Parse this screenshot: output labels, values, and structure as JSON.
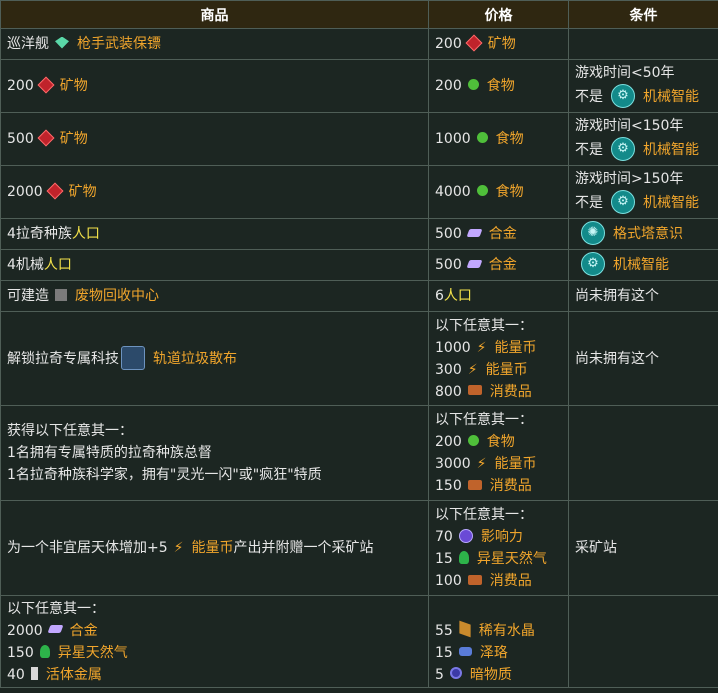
{
  "headers": {
    "col1": "商品",
    "col2": "价格",
    "col3": "条件"
  },
  "rows": [
    {
      "c1": {
        "pre": "巡洋舰",
        "name": "枪手武装保镖"
      },
      "c2": {
        "num": "200",
        "name": "矿物"
      }
    },
    {
      "c1": {
        "num": "200",
        "name": "矿物"
      },
      "c2": {
        "num": "200",
        "name": "食物"
      },
      "c3": {
        "cond": "游戏时间<50年",
        "neg": "不是",
        "name": "机械智能"
      }
    },
    {
      "c1": {
        "num": "500",
        "name": "矿物"
      },
      "c2": {
        "num": "1000",
        "name": "食物"
      },
      "c3": {
        "cond": "游戏时间<150年",
        "neg": "不是",
        "name": "机械智能"
      }
    },
    {
      "c1": {
        "num": "2000",
        "name": "矿物"
      },
      "c2": {
        "num": "4000",
        "name": "食物"
      },
      "c3": {
        "cond": "游戏时间>150年",
        "neg": "不是",
        "name": "机械智能"
      }
    },
    {
      "c1": {
        "pre": "4拉奇种族",
        "name": "人口"
      },
      "c2": {
        "num": "500",
        "name": "合金"
      },
      "c3": {
        "name": "格式塔意识"
      }
    },
    {
      "c1": {
        "pre": "4机械",
        "name": "人口"
      },
      "c2": {
        "num": "500",
        "name": "合金"
      },
      "c3": {
        "name": "机械智能"
      }
    },
    {
      "c1": {
        "pre": "可建造",
        "name": "废物回收中心"
      },
      "c2": {
        "num": "6",
        "name": "人口"
      },
      "c3": {
        "text": "尚未拥有这个"
      }
    },
    {
      "c1": {
        "pre": "解锁拉奇专属科技",
        "name": "轨道垃圾散布"
      },
      "c2": {
        "intro": "以下任意其一：",
        "items": [
          {
            "num": "1000",
            "name": "能量币"
          },
          {
            "num": "300",
            "name": "能量币"
          },
          {
            "num": "800",
            "name": "消费品"
          }
        ]
      },
      "c3": {
        "text": "尚未拥有这个"
      }
    },
    {
      "c1": {
        "lines": [
          "获得以下任意其一：",
          "1名拥有专属特质的拉奇种族总督",
          "1名拉奇种族科学家，拥有\"灵光一闪\"或\"疯狂\"特质"
        ]
      },
      "c2": {
        "intro": "以下任意其一：",
        "items": [
          {
            "num": "200",
            "name": "食物"
          },
          {
            "num": "3000",
            "name": "能量币"
          },
          {
            "num": "150",
            "name": "消费品"
          }
        ]
      }
    },
    {
      "c1": {
        "pre": "为一个非宜居天体增加+5",
        "name": "能量币",
        "post": "产出并附赠一个采矿站"
      },
      "c2": {
        "intro": "以下任意其一：",
        "items": [
          {
            "num": "70",
            "name": "影响力"
          },
          {
            "num": "15",
            "name": "异星天然气"
          },
          {
            "num": "100",
            "name": "消费品"
          }
        ]
      },
      "c3": {
        "text": "采矿站"
      }
    },
    {
      "c1": {
        "intro": "以下任意其一：",
        "items": [
          {
            "num": "2000",
            "name": "合金"
          },
          {
            "num": "150",
            "name": "异星天然气"
          },
          {
            "num": "40",
            "name": "活体金属"
          }
        ]
      },
      "c2": {
        "items": [
          {
            "num": "55",
            "name": "稀有水晶"
          },
          {
            "num": "15",
            "name": "泽珞"
          },
          {
            "num": "5",
            "name": "暗物质"
          }
        ]
      }
    }
  ]
}
